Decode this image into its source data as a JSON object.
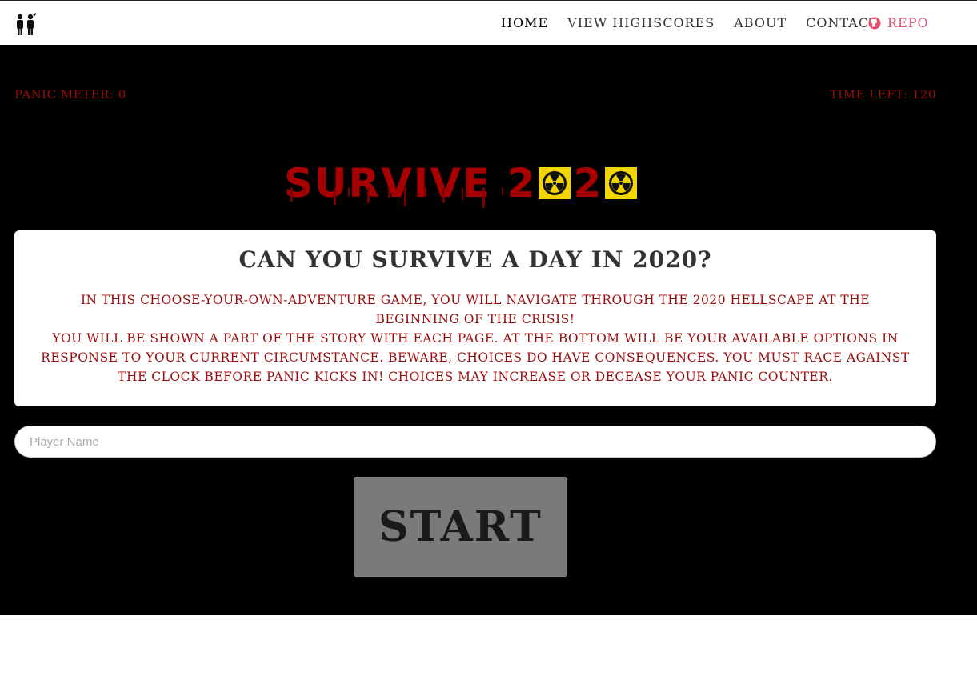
{
  "nav": {
    "links": [
      {
        "label": "Home"
      },
      {
        "label": "View Highscores"
      },
      {
        "label": "About"
      },
      {
        "label": "Contact"
      }
    ],
    "repo_label": "Repo",
    "logo_icon": "people-icon",
    "repo_icon": "github-icon"
  },
  "stats": {
    "panic_label": "Panic Meter: 0",
    "time_label": "Time Left: 120"
  },
  "title": {
    "text": "SURVIVE 2",
    "middle": "2",
    "hazard_icon": "radioactive-icon",
    "color": "#a80000"
  },
  "intro": {
    "heading": "Can you survive a day in 2020?",
    "line1": "In this choose-your-own-adventure game, you will navigate through the 2020 hellscape at the beginning of the crisis!",
    "line2": "You will be shown a part of the story with each page. At the bottom will be your available options in response to your current circumstance. Beware, choices do have consequences. You must race against the clock before panic kicks in! Choices may increase or decease your panic counter."
  },
  "form": {
    "player_placeholder": "Player Name",
    "start_label": "START"
  },
  "colors": {
    "accent_red": "#9b0b0b",
    "repo_pink": "#e0506a",
    "hazard_yellow": "#f2d400"
  }
}
